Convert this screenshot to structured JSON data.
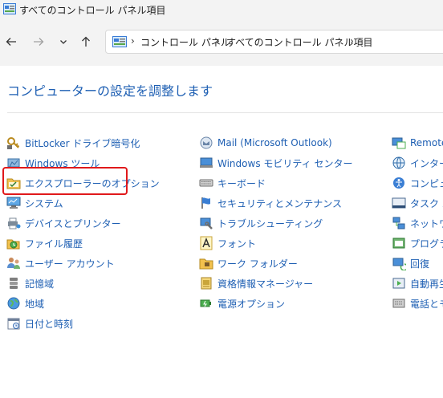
{
  "window": {
    "title": "すべてのコントロール パネル項目"
  },
  "address_bar": {
    "crumbs": [
      "コントロール パネル",
      "すべてのコントロール パネル項目"
    ]
  },
  "page": {
    "heading": "コンピューターの設定を調整します"
  },
  "columns": [
    {
      "items": [
        {
          "label": "BitLocker ドライブ暗号化",
          "icon": "bitlocker-key-icon"
        },
        {
          "label": "Windows ツール",
          "icon": "windows-tools-icon"
        },
        {
          "label": "エクスプローラーのオプション",
          "icon": "folder-options-icon"
        },
        {
          "label": "システム",
          "icon": "system-monitor-icon"
        },
        {
          "label": "デバイスとプリンター",
          "icon": "devices-printers-icon"
        },
        {
          "label": "ファイル履歴",
          "icon": "file-history-icon"
        },
        {
          "label": "ユーザー アカウント",
          "icon": "user-accounts-icon"
        },
        {
          "label": "記憶域",
          "icon": "storage-spaces-icon"
        },
        {
          "label": "地域",
          "icon": "region-globe-icon"
        },
        {
          "label": "日付と時刻",
          "icon": "date-time-icon"
        }
      ]
    },
    {
      "items": [
        {
          "label": "Mail (Microsoft Outlook)",
          "icon": "mail-icon"
        },
        {
          "label": "Windows モビリティ センター",
          "icon": "mobility-center-icon"
        },
        {
          "label": "キーボード",
          "icon": "keyboard-icon"
        },
        {
          "label": "セキュリティとメンテナンス",
          "icon": "security-flag-icon"
        },
        {
          "label": "トラブルシューティング",
          "icon": "troubleshooting-icon"
        },
        {
          "label": "フォント",
          "icon": "fonts-icon"
        },
        {
          "label": "ワーク フォルダー",
          "icon": "work-folders-icon"
        },
        {
          "label": "資格情報マネージャー",
          "icon": "credential-manager-icon"
        },
        {
          "label": "電源オプション",
          "icon": "power-options-icon"
        }
      ]
    },
    {
      "items": [
        {
          "label": "RemoteA",
          "icon": "remote-app-icon"
        },
        {
          "label": "インターネ",
          "icon": "internet-options-icon"
        },
        {
          "label": "コンピュー",
          "icon": "ease-of-access-icon"
        },
        {
          "label": "タスク バー",
          "icon": "taskbar-icon"
        },
        {
          "label": "ネットワー",
          "icon": "network-icon"
        },
        {
          "label": "プログラム",
          "icon": "programs-icon"
        },
        {
          "label": "回復",
          "icon": "recovery-icon"
        },
        {
          "label": "自動再生",
          "icon": "autoplay-icon"
        },
        {
          "label": "電話とモ",
          "icon": "phone-modem-icon"
        }
      ]
    }
  ],
  "highlight_color": "#e0191b",
  "link_color": "#1e5fb3"
}
